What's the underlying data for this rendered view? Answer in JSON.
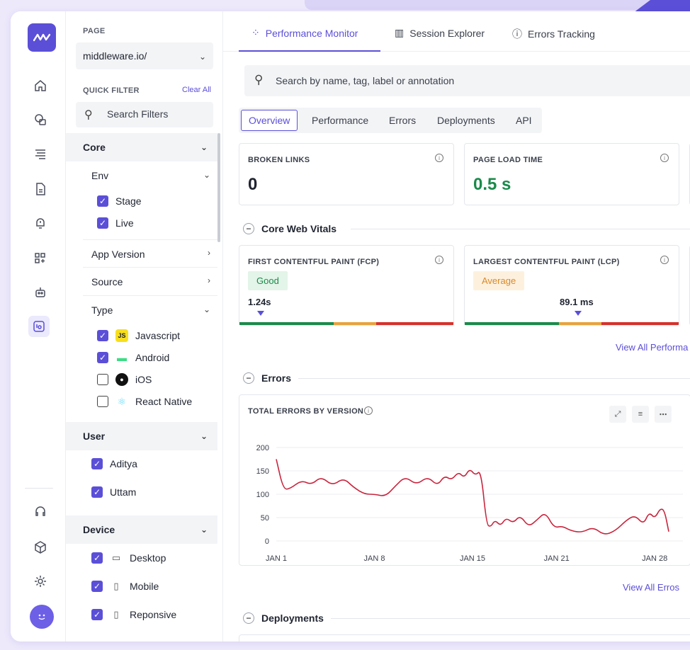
{
  "filters": {
    "page_label": "PAGE",
    "page_value": "middleware.io/",
    "quick_filter_label": "QUICK FILTER",
    "clear_all": "Clear All",
    "search_placeholder": "Search Filters",
    "core": {
      "title": "Core",
      "env": {
        "label": "Env",
        "options": [
          {
            "label": "Stage",
            "checked": true
          },
          {
            "label": "Live",
            "checked": true
          }
        ]
      },
      "app_version": "App Version",
      "source": "Source",
      "type": {
        "label": "Type",
        "options": [
          {
            "label": "Javascript",
            "checked": true,
            "icon": "js-icon"
          },
          {
            "label": "Android",
            "checked": true,
            "icon": "android-icon"
          },
          {
            "label": "iOS",
            "checked": false,
            "icon": "apple-icon"
          },
          {
            "label": "React Native",
            "checked": false,
            "icon": "react-icon"
          }
        ]
      }
    },
    "user": {
      "title": "User",
      "options": [
        {
          "label": "Aditya",
          "checked": true
        },
        {
          "label": "Uttam",
          "checked": true
        }
      ]
    },
    "device": {
      "title": "Device",
      "options": [
        {
          "label": "Desktop",
          "checked": true,
          "icon": "desktop-icon"
        },
        {
          "label": "Mobile",
          "checked": true,
          "icon": "mobile-icon"
        },
        {
          "label": "Reponsive",
          "checked": true,
          "icon": "tablet-icon"
        }
      ]
    }
  },
  "tabs": [
    {
      "label": "Performance Monitor",
      "icon": "performance-icon",
      "active": true
    },
    {
      "label": "Session Explorer",
      "icon": "bar-chart-icon",
      "active": false
    },
    {
      "label": "Errors Tracking",
      "icon": "alert-icon",
      "active": false
    }
  ],
  "search_placeholder": "Search by name, tag, label or annotation",
  "subtabs": [
    "Overview",
    "Performance",
    "Errors",
    "Deployments",
    "API"
  ],
  "metrics": {
    "broken_links": {
      "title": "BROKEN LINKS",
      "value": "0"
    },
    "page_load": {
      "title": "PAGE LOAD TIME",
      "value": "0.5 s"
    }
  },
  "sections": {
    "core_web_vitals": "Core Web Vitals",
    "errors": "Errors",
    "deployments": "Deployments"
  },
  "vitals": {
    "fcp": {
      "title": "FIRST CONTENTFUL PAINT (FCP)",
      "status": "Good",
      "value": "1.24s",
      "position": 0.1
    },
    "lcp": {
      "title": "LARGEST CONTENTFUL PAINT (LCP)",
      "status": "Average",
      "value": "89.1 ms",
      "position": 0.53
    }
  },
  "view_all_performance": "View All Performa",
  "view_all_errors": "View All Erros",
  "colors": {
    "accent": "#5b4fd8",
    "good": "#1a8a4a",
    "average": "#e8a33d",
    "bad": "#d6312b",
    "line": "#c8253d"
  },
  "chart_data": {
    "type": "line",
    "title": "TOTAL ERRORS BY VERSION",
    "x_ticks": [
      "JAN 1",
      "JAN 8",
      "JAN 15",
      "JAN 21",
      "JAN 28"
    ],
    "y_ticks": [
      "200",
      "150",
      "100",
      "50",
      "0"
    ],
    "ylim": [
      0,
      200
    ],
    "xlim": [
      0,
      28
    ],
    "grid": true,
    "series": [
      {
        "x": [
          0,
          0.5,
          1,
          1.8,
          2.5,
          3.2,
          4,
          4.8,
          5.5,
          6.3,
          7,
          7.8,
          8.5,
          9.2,
          10,
          10.8,
          11.5,
          12,
          12.5,
          13,
          13.4,
          13.8,
          14.2,
          14.6,
          15,
          15.3,
          15.6,
          16,
          16.4,
          16.9,
          17.4,
          18,
          18.6,
          19.2,
          19.8,
          20.4,
          21,
          21.8,
          22.6,
          23.4,
          24.2,
          25,
          25.6,
          26.2,
          26.6,
          27,
          27.4,
          27.7,
          28
        ],
        "y": [
          175,
          110,
          112,
          130,
          120,
          138,
          118,
          135,
          115,
          100,
          100,
          95,
          118,
          138,
          120,
          138,
          118,
          140,
          130,
          148,
          135,
          155,
          140,
          152,
          35,
          30,
          45,
          32,
          50,
          38,
          55,
          30,
          45,
          62,
          28,
          32,
          22,
          18,
          30,
          12,
          22,
          45,
          55,
          35,
          62,
          48,
          70,
          65,
          20
        ]
      }
    ]
  }
}
